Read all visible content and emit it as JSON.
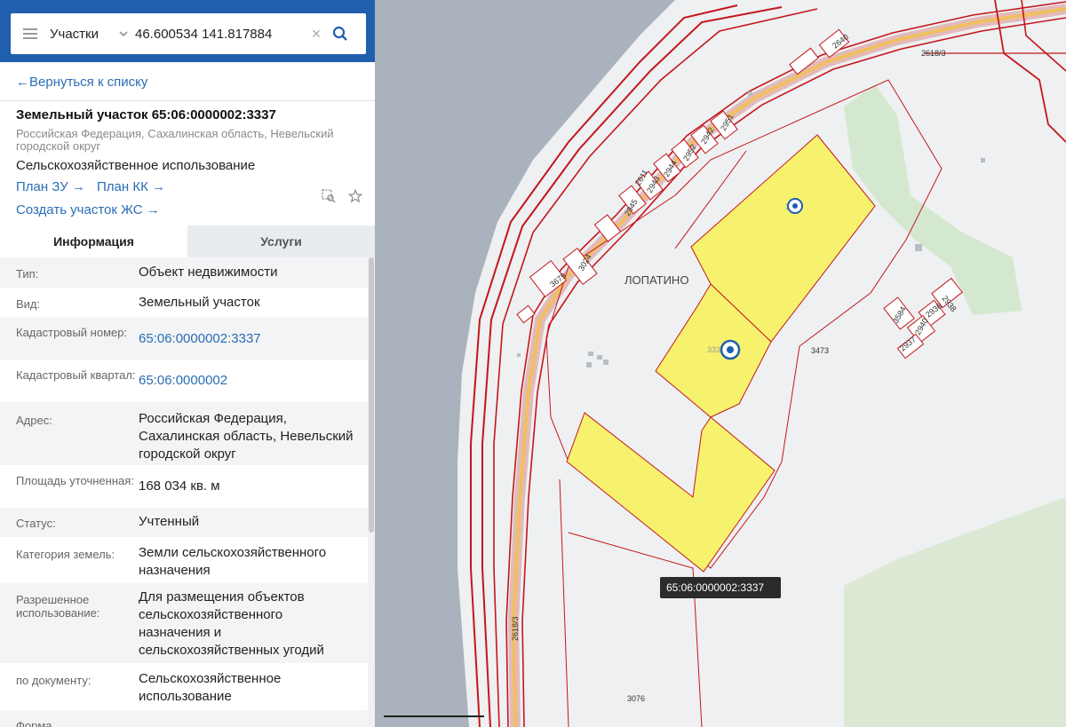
{
  "search": {
    "layer": "Участки",
    "query": "46.600534 141.817884",
    "menu_icon": "hamburger-icon",
    "search_icon": "magnifier-icon"
  },
  "back_link": "Вернуться к списку",
  "object": {
    "title": "Земельный участок 65:06:0000002:3337",
    "address_short": "Российская Федерация, Сахалинская область, Невельский городской округ",
    "usage": "Сельскохозяйственное использование",
    "links": {
      "plan_zu": "План ЗУ",
      "plan_kk": "План КК",
      "create_zhs": "Создать участок ЖС"
    }
  },
  "tabs": {
    "info": "Информация",
    "services": "Услуги"
  },
  "info_rows": [
    {
      "label": "Тип:",
      "value": "Объект недвижимости"
    },
    {
      "label": "Вид:",
      "value": "Земельный участок"
    },
    {
      "label": "Кадастровый номер:",
      "value": "65:06:0000002:3337"
    },
    {
      "label": "Кадастровый квартал:",
      "value": "65:06:0000002"
    },
    {
      "label": "Адрес:",
      "value": "Российская Федерация, Сахалинская область, Невельский городской округ"
    },
    {
      "label": "Площадь уточненная:",
      "value": "168 034 кв. м"
    },
    {
      "label": "Статус:",
      "value": "Учтенный"
    },
    {
      "label": "Категория земель:",
      "value": "Земли сельскохозяйственного назначения"
    },
    {
      "label": "Разрешенное использование:",
      "value": "Для размещения объектов сельскохозяйственного назначения и сельскохозяйственных угодий"
    },
    {
      "label": "по документу:",
      "value": "Сельскохозяйственное использование"
    },
    {
      "label": "Форма",
      "value": ""
    }
  ],
  "map": {
    "settlement": "ЛОПАТИНО",
    "tooltip": "65:06:0000002:3337",
    "marker_label_1": "33",
    "marker_label_2": "333",
    "parcel_numbers": {
      "p2640": "2640",
      "p2618_3_top": "2618/3",
      "p2951": "2951",
      "p2942": "2942",
      "p2952": "2952",
      "p2944": "2944",
      "p2943": "2943",
      "p2611": "2611",
      "p2945": "2945",
      "p3024": "3024",
      "p3679": "3679",
      "p2938": "2938",
      "p3584": "3584",
      "p2936": "2936",
      "p2940": "2940",
      "p2937": "2937",
      "p3473": "3473",
      "p2618_3_road": "2618/3",
      "p3076": "3076"
    },
    "colors": {
      "parcel_fill": "#f7f26e",
      "boundary": "#c4161c",
      "road": "#f0c060",
      "sea": "#a9b2bd",
      "land": "#eef0f1",
      "forest": "#d4e8cf",
      "panel_header": "#1f5fae",
      "link": "#2a6db5"
    }
  }
}
